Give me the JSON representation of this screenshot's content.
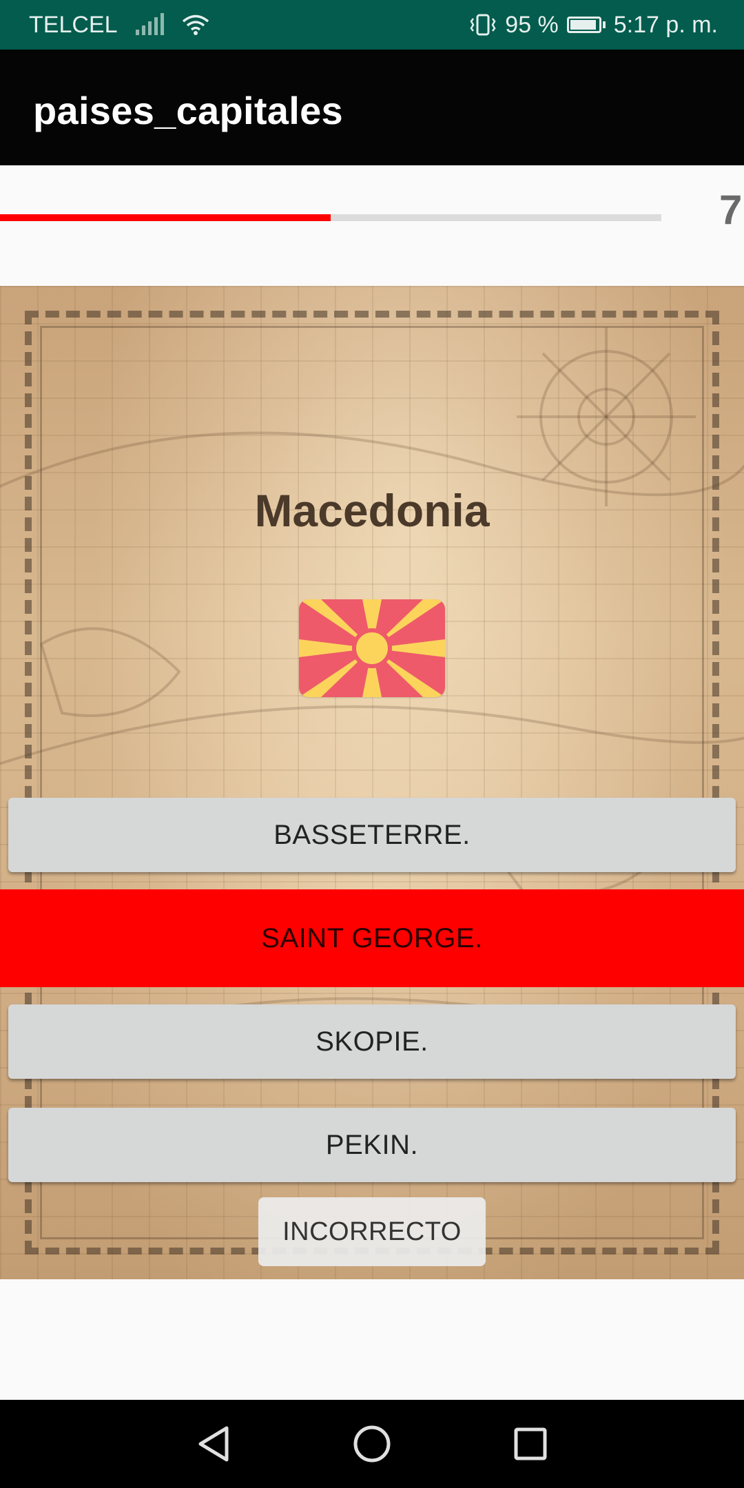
{
  "status_bar": {
    "carrier": "TELCEL",
    "battery": "95 %",
    "time": "5:17 p. m."
  },
  "app_bar": {
    "title": "paises_capitales"
  },
  "progress": {
    "fraction": 0.5,
    "fill_color": "#ff0000",
    "counter": "7"
  },
  "question": {
    "country": "Macedonia",
    "flag_icon": "macedonia-flag-icon"
  },
  "answers": [
    {
      "label": "BASSETERRE.",
      "state": "normal"
    },
    {
      "label": "SAINT GEORGE.",
      "state": "wrong"
    },
    {
      "label": "SKOPIE.",
      "state": "normal"
    },
    {
      "label": "PEKIN.",
      "state": "normal"
    }
  ],
  "result": {
    "label": "INCORRECTO"
  },
  "colors": {
    "status_bar": "#035c4d",
    "app_bar": "#050505",
    "wrong_answer": "#ff0000",
    "button": "#d6d7d7"
  },
  "nav_bar": {
    "back_icon": "back-triangle-icon",
    "home_icon": "home-circle-icon",
    "recents_icon": "recents-square-icon"
  }
}
